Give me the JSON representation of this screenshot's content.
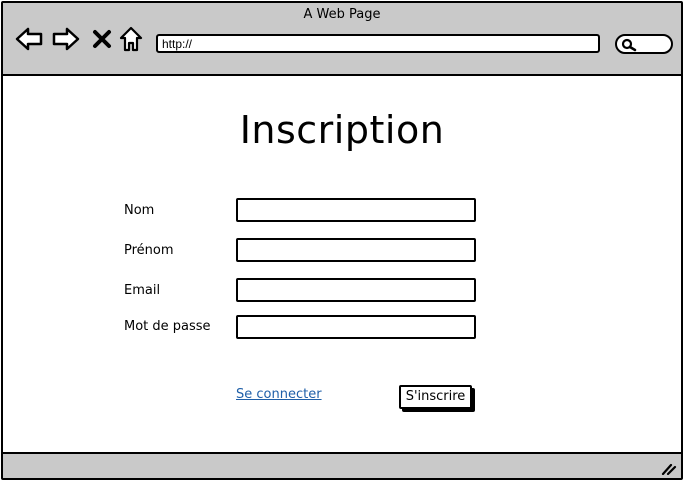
{
  "browser": {
    "window_title": "A Web Page",
    "url": "http://",
    "icons": {
      "back": "back-arrow-icon",
      "forward": "forward-arrow-icon",
      "stop": "close-icon",
      "home": "home-icon",
      "search": "search-icon",
      "resize": "resize-grip-icon"
    }
  },
  "page": {
    "title": "Inscription",
    "fields": [
      {
        "label": "Nom",
        "value": ""
      },
      {
        "label": "Prénom",
        "value": ""
      },
      {
        "label": "Email",
        "value": ""
      },
      {
        "label": "Mot de passe",
        "value": ""
      }
    ],
    "login_link": "Se connecter",
    "submit_label": "S'inscrire"
  },
  "colors": {
    "chrome_background": "#c9c9c9",
    "link": "#1f5fa8",
    "stroke": "#000000"
  }
}
